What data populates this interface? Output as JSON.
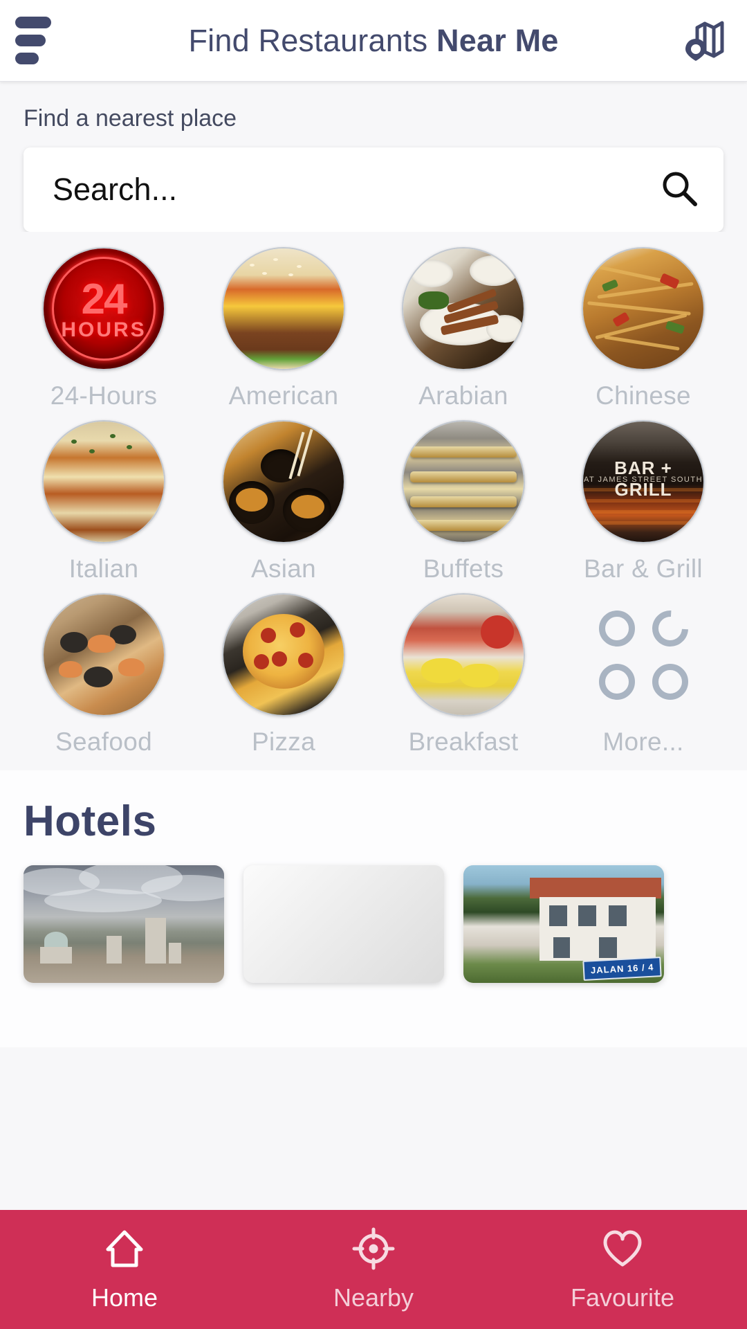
{
  "header": {
    "title_light": "Find Restaurants ",
    "title_bold": "Near Me",
    "menu_icon": "hamburger-icon",
    "map_icon": "map-pin-icon"
  },
  "search": {
    "label": "Find a nearest place",
    "placeholder": "Search...",
    "value": "",
    "search_icon": "search-icon"
  },
  "categories": [
    {
      "label": "24-Hours",
      "art": "24hours-neon-sign"
    },
    {
      "label": "American",
      "art": "cheeseburger"
    },
    {
      "label": "Arabian",
      "art": "grilled-meat-platter"
    },
    {
      "label": "Chinese",
      "art": "stir-fried-noodles"
    },
    {
      "label": "Italian",
      "art": "lasagna"
    },
    {
      "label": "Asian",
      "art": "asian-bowls"
    },
    {
      "label": "Buffets",
      "art": "buffet-trays"
    },
    {
      "label": "Bar & Grill",
      "art": "bar-grill-sign",
      "overlay_line1": "BAR + GRILL",
      "overlay_line2": "AT JAMES STREET SOUTH"
    },
    {
      "label": "Seafood",
      "art": "seafood-pan"
    },
    {
      "label": "Pizza",
      "art": "pepperoni-pizza-pan"
    },
    {
      "label": "Breakfast",
      "art": "breakfast-plate"
    },
    {
      "label": "More...",
      "art": "four-circles-icon"
    }
  ],
  "hotels": {
    "title": "Hotels",
    "cards": [
      {
        "art": "city-skyline-storm-clouds"
      },
      {
        "art": "blank-loading-card"
      },
      {
        "art": "house-with-street-sign",
        "sign_text": "JALAN 16 / 4"
      }
    ]
  },
  "bottom_nav": {
    "accent_color": "#cf2f56",
    "items": [
      {
        "label": "Home",
        "icon": "home-icon",
        "active": true
      },
      {
        "label": "Nearby",
        "icon": "target-icon",
        "active": false
      },
      {
        "label": "Favourite",
        "icon": "heart-icon",
        "active": false
      }
    ]
  }
}
